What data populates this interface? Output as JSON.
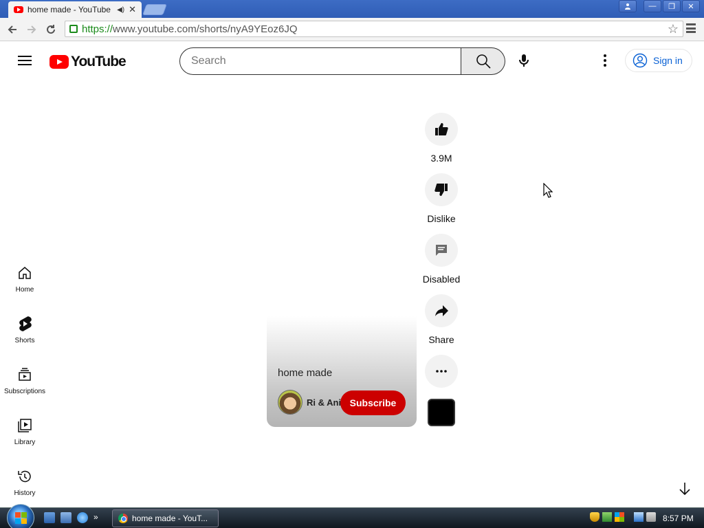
{
  "browser": {
    "tab_title": "home made - YouTube",
    "url_scheme": "https://",
    "url_rest": "www.youtube.com/shorts/nyA9YEoz6JQ"
  },
  "header": {
    "logo_text": "YouTube",
    "search_placeholder": "Search",
    "signin_label": "Sign in"
  },
  "sidebar": {
    "items": [
      {
        "label": "Home",
        "icon": "home-icon"
      },
      {
        "label": "Shorts",
        "icon": "shorts-icon"
      },
      {
        "label": "Subscriptions",
        "icon": "subscriptions-icon"
      },
      {
        "label": "Library",
        "icon": "library-icon"
      },
      {
        "label": "History",
        "icon": "history-icon"
      }
    ]
  },
  "short": {
    "title": "home made",
    "channel": "Ri & Ani",
    "subscribe_label": "Subscribe"
  },
  "actions": {
    "like_count": "3.9M",
    "dislike_label": "Dislike",
    "comments_label": "Disabled",
    "share_label": "Share"
  },
  "taskbar": {
    "task_label": "home made - YouT...",
    "clock": "8:57 PM"
  },
  "colors": {
    "brand_red": "#ff0000",
    "subscribe_red": "#cc0000",
    "link_blue": "#065fd4"
  }
}
